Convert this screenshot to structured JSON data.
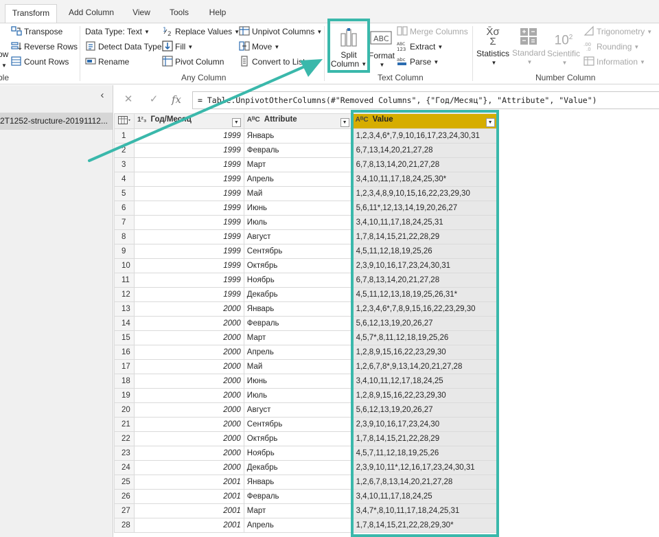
{
  "tabs": [
    {
      "label": "Transform",
      "active": true
    },
    {
      "label": "Add Column",
      "active": false
    },
    {
      "label": "View",
      "active": false
    },
    {
      "label": "Tools",
      "active": false
    },
    {
      "label": "Help",
      "active": false
    }
  ],
  "ribbon": {
    "table_group": {
      "transpose": "Transpose",
      "reverse_rows": "Reverse Rows",
      "count_rows": "Count Rows",
      "cut_label_1": "ow",
      "cut_label_2": "ble"
    },
    "any_column": {
      "data_type": "Data Type: Text",
      "detect_type": "Detect Data Type",
      "rename": "Rename",
      "replace_values": "Replace Values",
      "fill": "Fill",
      "pivot_column": "Pivot Column",
      "unpivot_columns": "Unpivot Columns",
      "move": "Move",
      "convert_to_list": "Convert to List",
      "group_label": "Any Column"
    },
    "text_column": {
      "split_column_line1": "Split",
      "split_column_line2": "Column",
      "format": "Format",
      "merge_columns": "Merge Columns",
      "extract": "Extract",
      "parse": "Parse",
      "group_label": "Text Column"
    },
    "number_column": {
      "statistics": "Statistics",
      "standard": "Standard",
      "scientific": "Scientific",
      "trigonometry": "Trigonometry",
      "rounding": "Rounding",
      "information": "Information",
      "group_label": "Number Column"
    }
  },
  "left_panel": {
    "query_name": "2T1252-structure-20191112..."
  },
  "formula": {
    "text": "= Table.UnpivotOtherColumns(#\"Removed Columns\", {\"Год/Месяц\"}, \"Attribute\", \"Value\")"
  },
  "table": {
    "columns": [
      {
        "type": "1²₃",
        "name": "Год/Месяц"
      },
      {
        "type": "AᴮC",
        "name": "Attribute"
      },
      {
        "type": "AᴮC",
        "name": "Value"
      }
    ],
    "rows": [
      [
        "1",
        "1999",
        "Январь",
        "1,2,3,4,6*,7,9,10,16,17,23,24,30,31"
      ],
      [
        "2",
        "1999",
        "Февраль",
        "6,7,13,14,20,21,27,28"
      ],
      [
        "3",
        "1999",
        "Март",
        "6,7,8,13,14,20,21,27,28"
      ],
      [
        "4",
        "1999",
        "Апрель",
        "3,4,10,11,17,18,24,25,30*"
      ],
      [
        "5",
        "1999",
        "Май",
        "1,2,3,4,8,9,10,15,16,22,23,29,30"
      ],
      [
        "6",
        "1999",
        "Июнь",
        "5,6,11*,12,13,14,19,20,26,27"
      ],
      [
        "7",
        "1999",
        "Июль",
        "3,4,10,11,17,18,24,25,31"
      ],
      [
        "8",
        "1999",
        "Август",
        "1,7,8,14,15,21,22,28,29"
      ],
      [
        "9",
        "1999",
        "Сентябрь",
        "4,5,11,12,18,19,25,26"
      ],
      [
        "10",
        "1999",
        "Октябрь",
        "2,3,9,10,16,17,23,24,30,31"
      ],
      [
        "11",
        "1999",
        "Ноябрь",
        "6,7,8,13,14,20,21,27,28"
      ],
      [
        "12",
        "1999",
        "Декабрь",
        "4,5,11,12,13,18,19,25,26,31*"
      ],
      [
        "13",
        "2000",
        "Январь",
        "1,2,3,4,6*,7,8,9,15,16,22,23,29,30"
      ],
      [
        "14",
        "2000",
        "Февраль",
        "5,6,12,13,19,20,26,27"
      ],
      [
        "15",
        "2000",
        "Март",
        "4,5,7*,8,11,12,18,19,25,26"
      ],
      [
        "16",
        "2000",
        "Апрель",
        "1,2,8,9,15,16,22,23,29,30"
      ],
      [
        "17",
        "2000",
        "Май",
        "1,2,6,7,8*,9,13,14,20,21,27,28"
      ],
      [
        "18",
        "2000",
        "Июнь",
        "3,4,10,11,12,17,18,24,25"
      ],
      [
        "19",
        "2000",
        "Июль",
        "1,2,8,9,15,16,22,23,29,30"
      ],
      [
        "20",
        "2000",
        "Август",
        "5,6,12,13,19,20,26,27"
      ],
      [
        "21",
        "2000",
        "Сентябрь",
        "2,3,9,10,16,17,23,24,30"
      ],
      [
        "22",
        "2000",
        "Октябрь",
        "1,7,8,14,15,21,22,28,29"
      ],
      [
        "23",
        "2000",
        "Ноябрь",
        "4,5,7,11,12,18,19,25,26"
      ],
      [
        "24",
        "2000",
        "Декабрь",
        "2,3,9,10,11*,12,16,17,23,24,30,31"
      ],
      [
        "25",
        "2001",
        "Январь",
        "1,2,6,7,8,13,14,20,21,27,28"
      ],
      [
        "26",
        "2001",
        "Февраль",
        "3,4,10,11,17,18,24,25"
      ],
      [
        "27",
        "2001",
        "Март",
        "3,4,7*,8,10,11,17,18,24,25,31"
      ],
      [
        "28",
        "2001",
        "Апрель",
        "1,7,8,14,15,21,22,28,29,30*"
      ]
    ]
  },
  "colors": {
    "highlight": "#3ab8ab",
    "value_header": "#d6ad00",
    "value_cells": "#e8e8e8"
  }
}
